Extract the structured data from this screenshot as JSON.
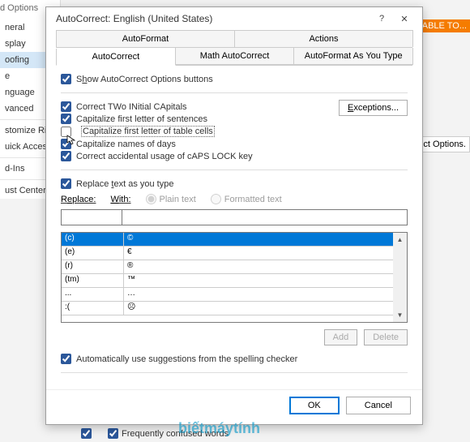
{
  "bg": {
    "options_title": "d Options",
    "sidebar": [
      "neral",
      "splay",
      "oofing",
      "e",
      "nguage",
      "vanced",
      "stomize Ri",
      "uick Access",
      "d-Ins",
      "ust Center"
    ],
    "table_btn": "TABLE TO...",
    "ect_btn": "ect Options.",
    "bottom_chk1": "",
    "bottom_chk2": "Frequently confused words"
  },
  "dialog": {
    "title": "AutoCorrect: English (United States)",
    "help_icon": "?",
    "close_icon": "✕",
    "tabs_row1": [
      "AutoFormat",
      "Actions"
    ],
    "tabs_row2": [
      "AutoCorrect",
      "Math AutoCorrect",
      "AutoFormat As You Type"
    ],
    "show_opts": "Show AutoCorrect Options buttons",
    "correct_two": "Correct TWo INitial CApitals",
    "cap_sentence": "Capitalize first letter of sentences",
    "cap_table": "Capitalize first letter of table cells",
    "cap_days": "Capitalize names of days",
    "caps_lock": "Correct accidental usage of cAPS LOCK key",
    "exceptions": "Exceptions...",
    "replace_type": "Replace text as you type",
    "replace_lbl": "Replace:",
    "with_lbl": "With:",
    "plain": "Plain text",
    "formatted": "Formatted text",
    "list": [
      {
        "r": "(c)",
        "w": "©"
      },
      {
        "r": "(e)",
        "w": "€"
      },
      {
        "r": "(r)",
        "w": "®"
      },
      {
        "r": "(tm)",
        "w": "™"
      },
      {
        "r": "...",
        "w": "…"
      },
      {
        "r": ":(",
        "w": "☹"
      }
    ],
    "add": "Add",
    "delete": "Delete",
    "auto_sugg": "Automatically use suggestions from the spelling checker",
    "ok": "OK",
    "cancel": "Cancel"
  },
  "watermark": "biếtmáytính"
}
